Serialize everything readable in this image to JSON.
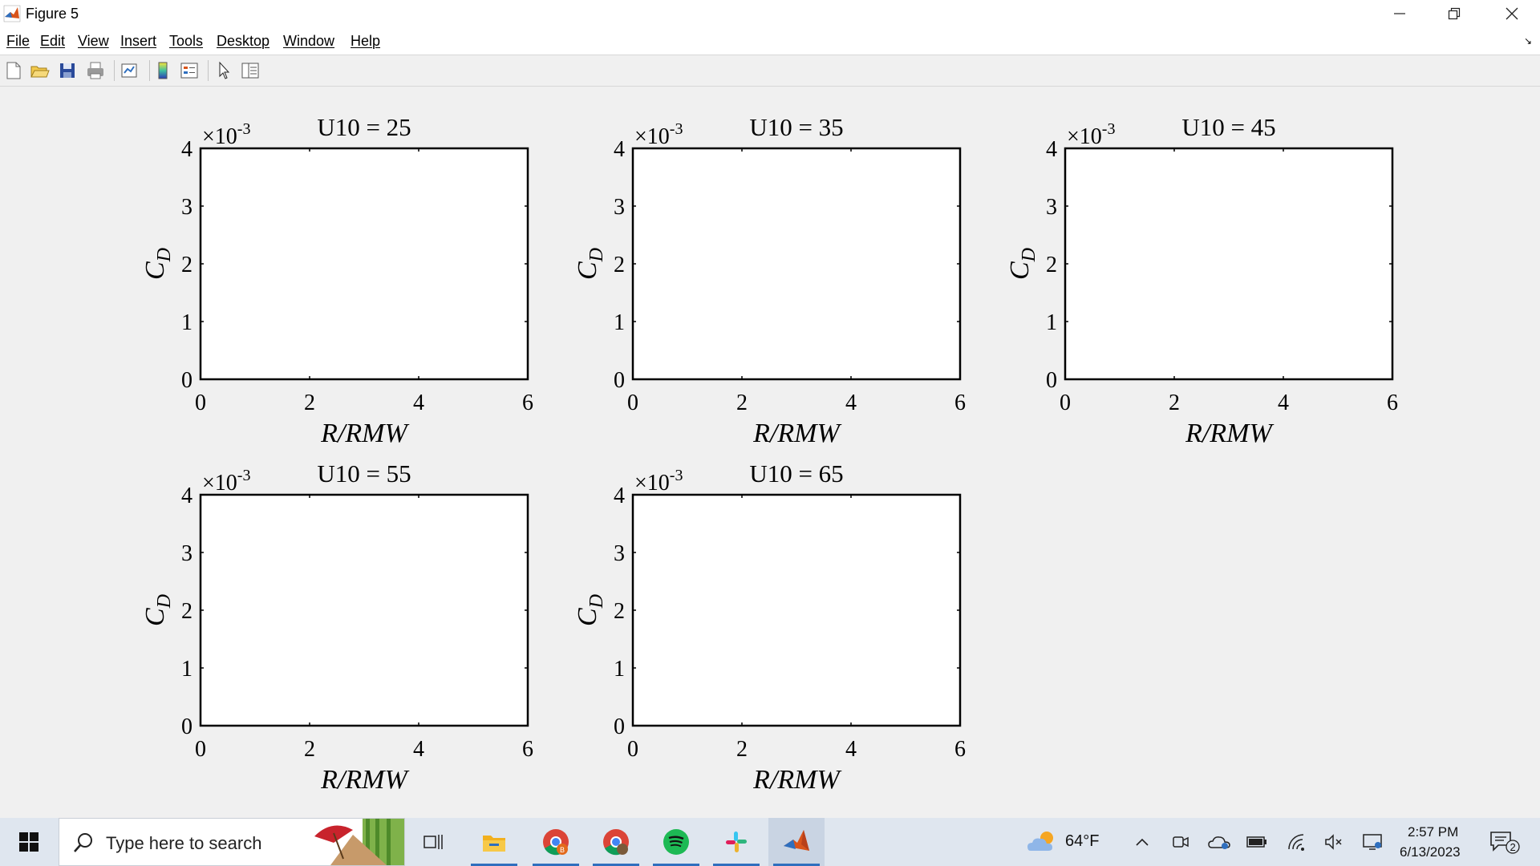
{
  "window": {
    "title": "Figure 5"
  },
  "menu": {
    "items": [
      "File",
      "Edit",
      "View",
      "Insert",
      "Tools",
      "Desktop",
      "Window",
      "Help"
    ]
  },
  "toolbar": {
    "icons": [
      "new-figure-icon",
      "open-file-icon",
      "save-icon",
      "print-icon",
      "link-plot-icon",
      "colorbar-icon",
      "legend-icon",
      "select-arrow-icon",
      "property-inspector-icon"
    ]
  },
  "colors": {
    "axes_bg": "#ffffff",
    "figure_bg": "#f0f0f0",
    "taskbar_bg": "#dfe6ef",
    "taskbar_underline": "#2f6fbe"
  },
  "chart_data": [
    {
      "type": "line",
      "title": "U10 = 25",
      "xlabel": "R/RMW",
      "ylabel": "C_D",
      "xlim": [
        0,
        6
      ],
      "ylim": [
        0,
        4
      ],
      "y_exponent": "×10^-3",
      "xticks": [
        "0",
        "2",
        "4",
        "6"
      ],
      "yticks": [
        "0",
        "1",
        "2",
        "3",
        "4"
      ],
      "series": []
    },
    {
      "type": "line",
      "title": "U10 = 35",
      "xlabel": "R/RMW",
      "ylabel": "C_D",
      "xlim": [
        0,
        6
      ],
      "ylim": [
        0,
        4
      ],
      "y_exponent": "×10^-3",
      "xticks": [
        "0",
        "2",
        "4",
        "6"
      ],
      "yticks": [
        "0",
        "1",
        "2",
        "3",
        "4"
      ],
      "series": []
    },
    {
      "type": "line",
      "title": "U10 = 45",
      "xlabel": "R/RMW",
      "ylabel": "C_D",
      "xlim": [
        0,
        6
      ],
      "ylim": [
        0,
        4
      ],
      "y_exponent": "×10^-3",
      "xticks": [
        "0",
        "2",
        "4",
        "6"
      ],
      "yticks": [
        "0",
        "1",
        "2",
        "3",
        "4"
      ],
      "series": []
    },
    {
      "type": "line",
      "title": "U10 = 55",
      "xlabel": "R/RMW",
      "ylabel": "C_D",
      "xlim": [
        0,
        6
      ],
      "ylim": [
        0,
        4
      ],
      "y_exponent": "×10^-3",
      "xticks": [
        "0",
        "2",
        "4",
        "6"
      ],
      "yticks": [
        "0",
        "1",
        "2",
        "3",
        "4"
      ],
      "series": []
    },
    {
      "type": "line",
      "title": "U10 = 65",
      "xlabel": "R/RMW",
      "ylabel": "C_D",
      "xlim": [
        0,
        6
      ],
      "ylim": [
        0,
        4
      ],
      "y_exponent": "×10^-3",
      "xticks": [
        "0",
        "2",
        "4",
        "6"
      ],
      "yticks": [
        "0",
        "1",
        "2",
        "3",
        "4"
      ],
      "series": []
    }
  ],
  "taskbar": {
    "search_placeholder": "Type here to search",
    "apps": [
      "task-view-icon",
      "file-explorer-icon",
      "chrome-icon",
      "chrome-profile-icon",
      "spotify-icon",
      "slack-icon",
      "matlab-icon"
    ],
    "weather": "64°F",
    "time": "2:57 PM",
    "date": "6/13/2023",
    "notification_count": "2"
  }
}
